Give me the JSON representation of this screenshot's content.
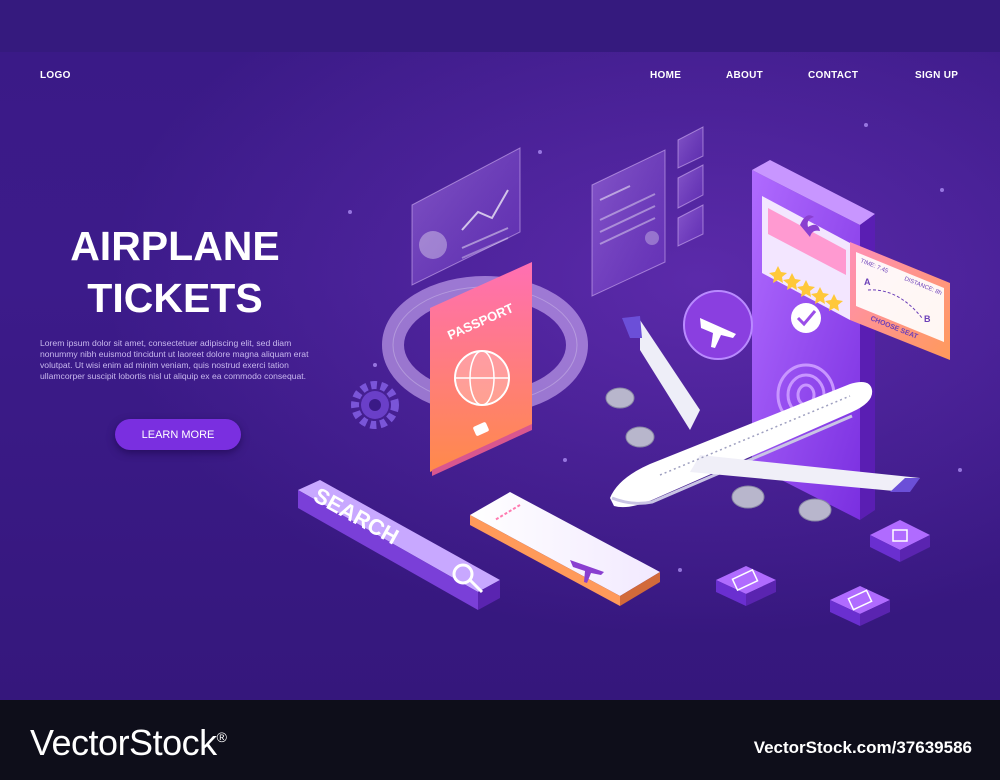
{
  "nav": {
    "logo": "LOGO",
    "links": [
      "HOME",
      "ABOUT",
      "CONTACT",
      "SIGN UP"
    ]
  },
  "hero": {
    "title_line1": "AIRPLANE",
    "title_line2": "TICKETS",
    "body": "Lorem ipsum dolor sit amet, consectetuer adipiscing elit, sed diam nonummy nibh euismod tincidunt ut laoreet dolore magna aliquam erat volutpat. Ut wisi enim ad minim veniam, quis nostrud exerci tation ullamcorper suscipit lobortis nisl ut aliquip ex ea commodo consequat.",
    "cta_label": "LEARN MORE"
  },
  "illustration": {
    "passport_label": "PASSPORT",
    "search_label": "SEARCH",
    "seat_card": {
      "time_label": "TIME: 7.45",
      "distance_label": "DISTANCE: 8h",
      "from": "A",
      "to": "B",
      "button_label": "CHOOSE SEAT"
    },
    "rating_stars": 5,
    "icons": [
      "chart-panel-icon",
      "gear-icon",
      "globe-icon",
      "magnifier-icon",
      "airplane-icon",
      "checkmark-icon",
      "fingerprint-icon",
      "credit-card-icon",
      "suitcase-icon",
      "lock-icon",
      "palm-tree-icon"
    ]
  },
  "watermark": {
    "brand": "VectorStock",
    "registered": "®",
    "url": "VectorStock.com/37639586"
  },
  "colors": {
    "background": "#3a1a86",
    "accent": "#7a2fe0",
    "footer": "#0e0e1a"
  }
}
